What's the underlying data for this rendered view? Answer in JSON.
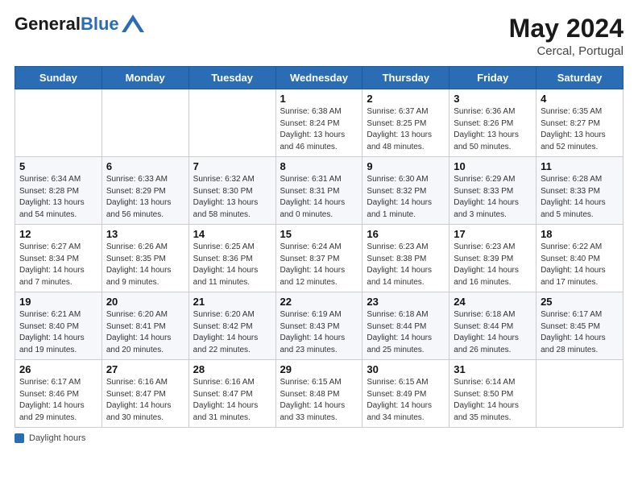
{
  "header": {
    "logo_general": "General",
    "logo_blue": "Blue",
    "month_year": "May 2024",
    "location": "Cercal, Portugal"
  },
  "footer": {
    "label": "Daylight hours"
  },
  "calendar": {
    "headers": [
      "Sunday",
      "Monday",
      "Tuesday",
      "Wednesday",
      "Thursday",
      "Friday",
      "Saturday"
    ],
    "weeks": [
      [
        {
          "day": "",
          "info": ""
        },
        {
          "day": "",
          "info": ""
        },
        {
          "day": "",
          "info": ""
        },
        {
          "day": "1",
          "info": "Sunrise: 6:38 AM\nSunset: 8:24 PM\nDaylight: 13 hours\nand 46 minutes."
        },
        {
          "day": "2",
          "info": "Sunrise: 6:37 AM\nSunset: 8:25 PM\nDaylight: 13 hours\nand 48 minutes."
        },
        {
          "day": "3",
          "info": "Sunrise: 6:36 AM\nSunset: 8:26 PM\nDaylight: 13 hours\nand 50 minutes."
        },
        {
          "day": "4",
          "info": "Sunrise: 6:35 AM\nSunset: 8:27 PM\nDaylight: 13 hours\nand 52 minutes."
        }
      ],
      [
        {
          "day": "5",
          "info": "Sunrise: 6:34 AM\nSunset: 8:28 PM\nDaylight: 13 hours\nand 54 minutes."
        },
        {
          "day": "6",
          "info": "Sunrise: 6:33 AM\nSunset: 8:29 PM\nDaylight: 13 hours\nand 56 minutes."
        },
        {
          "day": "7",
          "info": "Sunrise: 6:32 AM\nSunset: 8:30 PM\nDaylight: 13 hours\nand 58 minutes."
        },
        {
          "day": "8",
          "info": "Sunrise: 6:31 AM\nSunset: 8:31 PM\nDaylight: 14 hours\nand 0 minutes."
        },
        {
          "day": "9",
          "info": "Sunrise: 6:30 AM\nSunset: 8:32 PM\nDaylight: 14 hours\nand 1 minute."
        },
        {
          "day": "10",
          "info": "Sunrise: 6:29 AM\nSunset: 8:33 PM\nDaylight: 14 hours\nand 3 minutes."
        },
        {
          "day": "11",
          "info": "Sunrise: 6:28 AM\nSunset: 8:33 PM\nDaylight: 14 hours\nand 5 minutes."
        }
      ],
      [
        {
          "day": "12",
          "info": "Sunrise: 6:27 AM\nSunset: 8:34 PM\nDaylight: 14 hours\nand 7 minutes."
        },
        {
          "day": "13",
          "info": "Sunrise: 6:26 AM\nSunset: 8:35 PM\nDaylight: 14 hours\nand 9 minutes."
        },
        {
          "day": "14",
          "info": "Sunrise: 6:25 AM\nSunset: 8:36 PM\nDaylight: 14 hours\nand 11 minutes."
        },
        {
          "day": "15",
          "info": "Sunrise: 6:24 AM\nSunset: 8:37 PM\nDaylight: 14 hours\nand 12 minutes."
        },
        {
          "day": "16",
          "info": "Sunrise: 6:23 AM\nSunset: 8:38 PM\nDaylight: 14 hours\nand 14 minutes."
        },
        {
          "day": "17",
          "info": "Sunrise: 6:23 AM\nSunset: 8:39 PM\nDaylight: 14 hours\nand 16 minutes."
        },
        {
          "day": "18",
          "info": "Sunrise: 6:22 AM\nSunset: 8:40 PM\nDaylight: 14 hours\nand 17 minutes."
        }
      ],
      [
        {
          "day": "19",
          "info": "Sunrise: 6:21 AM\nSunset: 8:40 PM\nDaylight: 14 hours\nand 19 minutes."
        },
        {
          "day": "20",
          "info": "Sunrise: 6:20 AM\nSunset: 8:41 PM\nDaylight: 14 hours\nand 20 minutes."
        },
        {
          "day": "21",
          "info": "Sunrise: 6:20 AM\nSunset: 8:42 PM\nDaylight: 14 hours\nand 22 minutes."
        },
        {
          "day": "22",
          "info": "Sunrise: 6:19 AM\nSunset: 8:43 PM\nDaylight: 14 hours\nand 23 minutes."
        },
        {
          "day": "23",
          "info": "Sunrise: 6:18 AM\nSunset: 8:44 PM\nDaylight: 14 hours\nand 25 minutes."
        },
        {
          "day": "24",
          "info": "Sunrise: 6:18 AM\nSunset: 8:44 PM\nDaylight: 14 hours\nand 26 minutes."
        },
        {
          "day": "25",
          "info": "Sunrise: 6:17 AM\nSunset: 8:45 PM\nDaylight: 14 hours\nand 28 minutes."
        }
      ],
      [
        {
          "day": "26",
          "info": "Sunrise: 6:17 AM\nSunset: 8:46 PM\nDaylight: 14 hours\nand 29 minutes."
        },
        {
          "day": "27",
          "info": "Sunrise: 6:16 AM\nSunset: 8:47 PM\nDaylight: 14 hours\nand 30 minutes."
        },
        {
          "day": "28",
          "info": "Sunrise: 6:16 AM\nSunset: 8:47 PM\nDaylight: 14 hours\nand 31 minutes."
        },
        {
          "day": "29",
          "info": "Sunrise: 6:15 AM\nSunset: 8:48 PM\nDaylight: 14 hours\nand 33 minutes."
        },
        {
          "day": "30",
          "info": "Sunrise: 6:15 AM\nSunset: 8:49 PM\nDaylight: 14 hours\nand 34 minutes."
        },
        {
          "day": "31",
          "info": "Sunrise: 6:14 AM\nSunset: 8:50 PM\nDaylight: 14 hours\nand 35 minutes."
        },
        {
          "day": "",
          "info": ""
        }
      ]
    ]
  }
}
